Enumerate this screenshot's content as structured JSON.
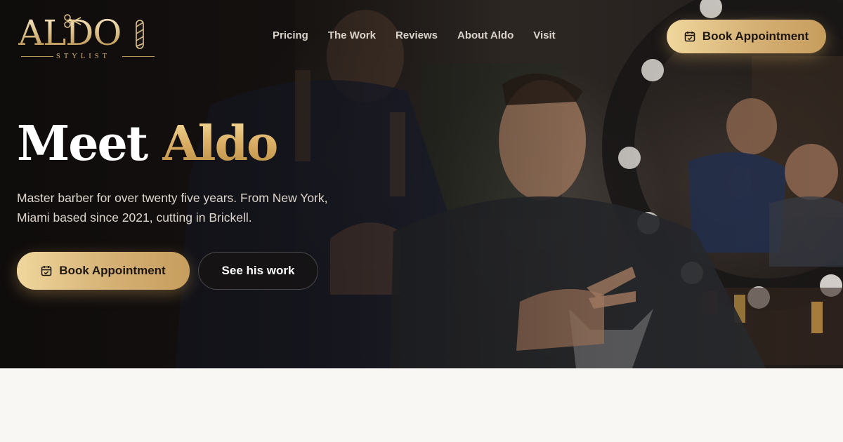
{
  "brand": {
    "name": "ALDO",
    "tagline": "STYLIST"
  },
  "nav": {
    "links": [
      {
        "label": "Pricing"
      },
      {
        "label": "The Work"
      },
      {
        "label": "Reviews"
      },
      {
        "label": "About Aldo"
      },
      {
        "label": "Visit"
      }
    ],
    "book_label": "Book Appointment"
  },
  "hero": {
    "title_plain": "Meet",
    "title_accent": "Aldo",
    "subtitle_lines": [
      "Master barber for over twenty five years. From New York,",
      "Miami based since 2021, cutting in Brickell."
    ],
    "book_label": "Book Appointment",
    "work_label": "See his work"
  },
  "icons": {
    "calendar": "calendar-icon",
    "barber_pole": "barber-pole-icon"
  },
  "colors": {
    "gold": "#d5b074",
    "gold_light": "#f0d79d",
    "dark": "#1a1614",
    "page_bg": "#f8f7f3"
  }
}
